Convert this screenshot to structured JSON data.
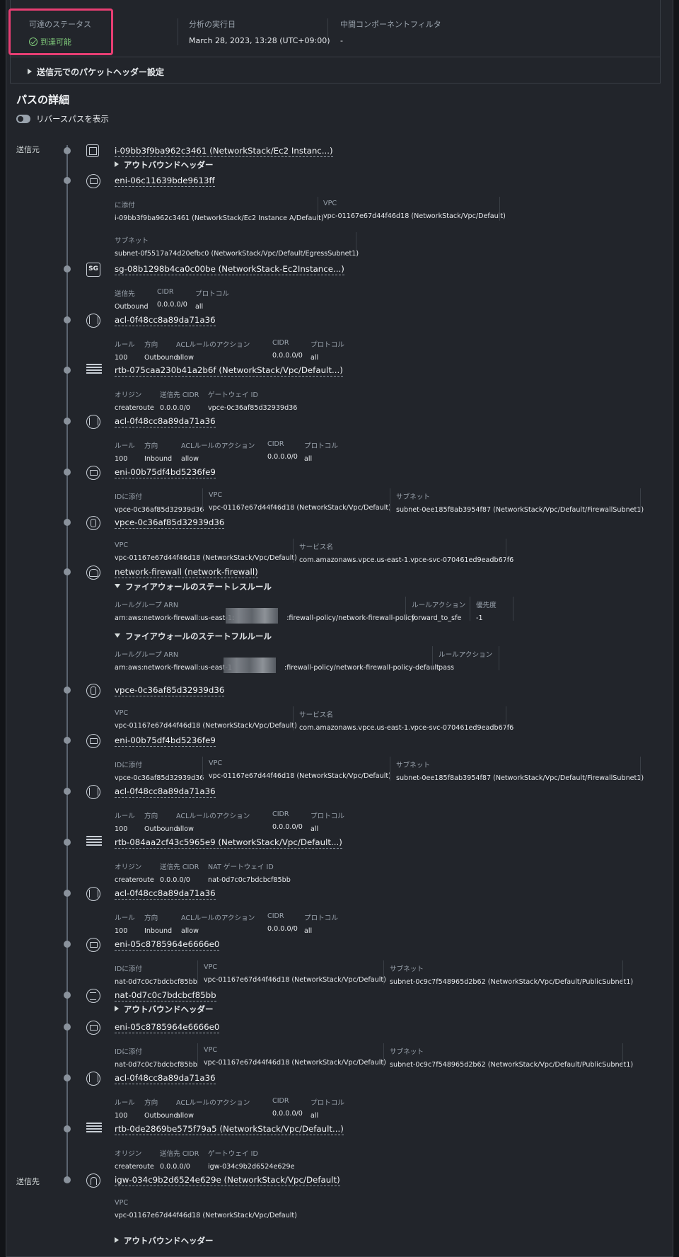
{
  "summary": {
    "status_label": "可達のステータス",
    "status_value": "到達可能",
    "run_label": "分析の実行日",
    "run_value": "March 28, 2023, 13:28 (UTC+09:00)",
    "filter_label": "中間コンポーネントフィルタ",
    "filter_value": "-",
    "expand_header": "送信元でのパケットヘッダー設定"
  },
  "path": {
    "heading": "パスの詳細",
    "toggle_label": "リバースパスを表示",
    "source_label": "送信元",
    "dest_label": "送信先",
    "outbound_header": "アウトバウンドヘッダー",
    "stateless_header": "ファイアウォールのステートレスルール",
    "stateful_header": "ファイアウォールのステートフルルール"
  },
  "colors": {
    "success": "#7fc97a",
    "highlight": "#e83e73"
  },
  "nodes": [
    {
      "icon": "instance-icon",
      "title": "i-09bb3f9ba962c3461 (NetworkStack/Ec2 Instanc...)"
    },
    {
      "icon": "eni-icon",
      "title": "eni-06c11639bde9613ff",
      "fields": [
        {
          "label": "に添付",
          "value": "i-09bb3f9ba962c3461 (NetworkStack/Ec2 Instance A/Default)"
        },
        {
          "label": "VPC",
          "value": "vpc-01167e67d44f46d18 (NetworkStack/Vpc/Default)"
        },
        {
          "label": "サブネット",
          "value": "subnet-0f5517a74d20efbc0 (NetworkStack/Vpc/Default/EgressSubnet1)"
        }
      ]
    },
    {
      "icon": "security-group-icon",
      "icon_text": "SG",
      "title": "sg-08b1298b4ca0c00be (NetworkStack-Ec2Instance...)",
      "fields": [
        {
          "label": "送信先",
          "value": "Outbound"
        },
        {
          "label": "CIDR",
          "value": "0.0.0.0/0"
        },
        {
          "label": "プロトコル",
          "value": "all"
        }
      ]
    },
    {
      "icon": "network-acl-icon",
      "title": "acl-0f48cc8a89da71a36",
      "fields": [
        {
          "label": "ルール",
          "value": "100"
        },
        {
          "label": "方向",
          "value": "Outbound"
        },
        {
          "label": "ACLルールのアクション",
          "value": "allow"
        },
        {
          "label": "CIDR",
          "value": "0.0.0.0/0"
        },
        {
          "label": "プロトコル",
          "value": "all"
        }
      ]
    },
    {
      "icon": "route-table-icon",
      "title": "rtb-075caa230b41a2b6f (NetworkStack/Vpc/Default...)",
      "fields": [
        {
          "label": "オリジン",
          "value": "createroute"
        },
        {
          "label": "送信先 CIDR",
          "value": "0.0.0.0/0"
        },
        {
          "label": "ゲートウェイ ID",
          "value": "vpce-0c36af85d32939d36"
        }
      ]
    },
    {
      "icon": "network-acl-icon",
      "title": "acl-0f48cc8a89da71a36",
      "fields": [
        {
          "label": "ルール",
          "value": "100"
        },
        {
          "label": "方向",
          "value": "Inbound"
        },
        {
          "label": "ACLルールのアクション",
          "value": "allow"
        },
        {
          "label": "CIDR",
          "value": "0.0.0.0/0"
        },
        {
          "label": "プロトコル",
          "value": "all"
        }
      ]
    },
    {
      "icon": "eni-icon",
      "title": "eni-00b75df4bd5236fe9",
      "fields": [
        {
          "label": "IDに添付",
          "value": "vpce-0c36af85d32939d36"
        },
        {
          "label": "VPC",
          "value": "vpc-01167e67d44f46d18 (NetworkStack/Vpc/Default)"
        },
        {
          "label": "サブネット",
          "value": "subnet-0ee185f8ab3954f87 (NetworkStack/Vpc/Default/FirewallSubnet1)"
        }
      ]
    },
    {
      "icon": "vpc-endpoint-icon",
      "title": "vpce-0c36af85d32939d36",
      "fields": [
        {
          "label": "VPC",
          "value": "vpc-01167e67d44f46d18 (NetworkStack/Vpc/Default)"
        },
        {
          "label": "サービス名",
          "value": "com.amazonaws.vpce.us-east-1.vpce-svc-070461ed9eadb67f6"
        }
      ]
    },
    {
      "icon": "network-firewall-icon",
      "title": "network-firewall (network-firewall)",
      "stateless": [
        {
          "label": "ルールグループ ARN",
          "value_a": "arn:aws:network-firewall:us-east-1:",
          "value_b": ":firewall-policy/network-firewall-policy"
        },
        {
          "label": "ルールアクション",
          "value": "forward_to_sfe"
        },
        {
          "label": "優先度",
          "value": "-1"
        }
      ],
      "stateful": [
        {
          "label": "ルールグループ ARN",
          "value_a": "arn:aws:network-firewall:us-east-1",
          "value_b": ":firewall-policy/network-firewall-policy-default"
        },
        {
          "label": "ルールアクション",
          "value": "pass"
        }
      ]
    },
    {
      "icon": "vpc-endpoint-icon",
      "title": "vpce-0c36af85d32939d36",
      "fields": [
        {
          "label": "VPC",
          "value": "vpc-01167e67d44f46d18 (NetworkStack/Vpc/Default)"
        },
        {
          "label": "サービス名",
          "value": "com.amazonaws.vpce.us-east-1.vpce-svc-070461ed9eadb67f6"
        }
      ]
    },
    {
      "icon": "eni-icon",
      "title": "eni-00b75df4bd5236fe9",
      "fields": [
        {
          "label": "IDに添付",
          "value": "vpce-0c36af85d32939d36"
        },
        {
          "label": "VPC",
          "value": "vpc-01167e67d44f46d18 (NetworkStack/Vpc/Default)"
        },
        {
          "label": "サブネット",
          "value": "subnet-0ee185f8ab3954f87 (NetworkStack/Vpc/Default/FirewallSubnet1)"
        }
      ]
    },
    {
      "icon": "network-acl-icon",
      "title": "acl-0f48cc8a89da71a36",
      "fields": [
        {
          "label": "ルール",
          "value": "100"
        },
        {
          "label": "方向",
          "value": "Outbound"
        },
        {
          "label": "ACLルールのアクション",
          "value": "allow"
        },
        {
          "label": "CIDR",
          "value": "0.0.0.0/0"
        },
        {
          "label": "プロトコル",
          "value": "all"
        }
      ]
    },
    {
      "icon": "route-table-icon",
      "title": "rtb-084aa2cf43c5965e9 (NetworkStack/Vpc/Default...)",
      "fields": [
        {
          "label": "オリジン",
          "value": "createroute"
        },
        {
          "label": "送信先 CIDR",
          "value": "0.0.0.0/0"
        },
        {
          "label": "NAT ゲートウェイ ID",
          "value": "nat-0d7c0c7bdcbcf85bb"
        }
      ]
    },
    {
      "icon": "network-acl-icon",
      "title": "acl-0f48cc8a89da71a36",
      "fields": [
        {
          "label": "ルール",
          "value": "100"
        },
        {
          "label": "方向",
          "value": "Inbound"
        },
        {
          "label": "ACLルールのアクション",
          "value": "allow"
        },
        {
          "label": "CIDR",
          "value": "0.0.0.0/0"
        },
        {
          "label": "プロトコル",
          "value": "all"
        }
      ]
    },
    {
      "icon": "eni-icon",
      "title": "eni-05c8785964e6666e0",
      "fields": [
        {
          "label": "IDに添付",
          "value": "nat-0d7c0c7bdcbcf85bb"
        },
        {
          "label": "VPC",
          "value": "vpc-01167e67d44f46d18 (NetworkStack/Vpc/Default)"
        },
        {
          "label": "サブネット",
          "value": "subnet-0c9c7f548965d2b62 (NetworkStack/Vpc/Default/PublicSubnet1)"
        }
      ]
    },
    {
      "icon": "nat-gateway-icon",
      "title": "nat-0d7c0c7bdcbcf85bb"
    },
    {
      "icon": "eni-icon",
      "title": "eni-05c8785964e6666e0",
      "fields": [
        {
          "label": "IDに添付",
          "value": "nat-0d7c0c7bdcbcf85bb"
        },
        {
          "label": "VPC",
          "value": "vpc-01167e67d44f46d18 (NetworkStack/Vpc/Default)"
        },
        {
          "label": "サブネット",
          "value": "subnet-0c9c7f548965d2b62 (NetworkStack/Vpc/Default/PublicSubnet1)"
        }
      ]
    },
    {
      "icon": "network-acl-icon",
      "title": "acl-0f48cc8a89da71a36",
      "fields": [
        {
          "label": "ルール",
          "value": "100"
        },
        {
          "label": "方向",
          "value": "Outbound"
        },
        {
          "label": "ACLルールのアクション",
          "value": "allow"
        },
        {
          "label": "CIDR",
          "value": "0.0.0.0/0"
        },
        {
          "label": "プロトコル",
          "value": "all"
        }
      ]
    },
    {
      "icon": "route-table-icon",
      "title": "rtb-0de2869be575f79a5 (NetworkStack/Vpc/Default...)",
      "fields": [
        {
          "label": "オリジン",
          "value": "createroute"
        },
        {
          "label": "送信先 CIDR",
          "value": "0.0.0.0/0"
        },
        {
          "label": "ゲートウェイ ID",
          "value": "igw-034c9b2d6524e629e"
        }
      ]
    },
    {
      "icon": "internet-gateway-icon",
      "title": "igw-034c9b2d6524e629e (NetworkStack/Vpc/Default)",
      "fields": [
        {
          "label": "VPC",
          "value": "vpc-01167e67d44f46d18 (NetworkStack/Vpc/Default)"
        }
      ]
    }
  ]
}
